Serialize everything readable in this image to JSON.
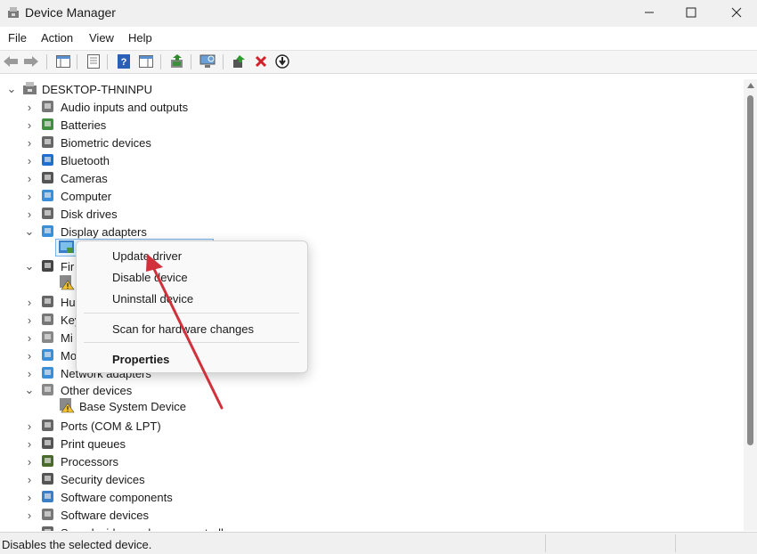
{
  "window": {
    "title": "Device Manager",
    "minimize": "—",
    "maximize": "☐",
    "close": "✕"
  },
  "menu": [
    "File",
    "Action",
    "View",
    "Help"
  ],
  "toolbar": {
    "icons": [
      "back-icon",
      "forward-icon",
      "show-hide-console-tree-icon",
      "properties-icon",
      "help-icon",
      "action-pane-icon",
      "update-driver-icon",
      "scan-hardware-icon",
      "enable-device-icon",
      "uninstall-device-icon",
      "disable-device-icon"
    ]
  },
  "tree": {
    "root": "DESKTOP-THNINPU",
    "items": [
      {
        "label": "Audio inputs and outputs",
        "icon": "speaker-icon",
        "expanded": false
      },
      {
        "label": "Batteries",
        "icon": "battery-icon",
        "expanded": false
      },
      {
        "label": "Biometric devices",
        "icon": "fingerprint-icon",
        "expanded": false
      },
      {
        "label": "Bluetooth",
        "icon": "bluetooth-icon",
        "expanded": false
      },
      {
        "label": "Cameras",
        "icon": "camera-icon",
        "expanded": false
      },
      {
        "label": "Computer",
        "icon": "monitor-icon",
        "expanded": false
      },
      {
        "label": "Disk drives",
        "icon": "disk-icon",
        "expanded": false
      },
      {
        "label": "Display adapters",
        "icon": "display-adapter-icon",
        "expanded": true
      },
      {
        "label": "Fir",
        "icon": "firmware-icon",
        "expanded": true
      },
      {
        "label": "Hu",
        "icon": "hid-icon",
        "expanded": false
      },
      {
        "label": "Key",
        "icon": "keyboard-icon",
        "expanded": false
      },
      {
        "label": "Mi",
        "icon": "mouse-icon",
        "expanded": false
      },
      {
        "label": "Mo",
        "icon": "monitor-icon",
        "expanded": false
      },
      {
        "label": "Network adapters",
        "icon": "network-icon",
        "expanded": false
      },
      {
        "label": "Other devices",
        "icon": "other-devices-icon",
        "expanded": true
      },
      {
        "label": "Ports (COM & LPT)",
        "icon": "port-icon",
        "expanded": false
      },
      {
        "label": "Print queues",
        "icon": "printer-icon",
        "expanded": false
      },
      {
        "label": "Processors",
        "icon": "processor-icon",
        "expanded": false
      },
      {
        "label": "Security devices",
        "icon": "security-icon",
        "expanded": false
      },
      {
        "label": "Software components",
        "icon": "software-icon",
        "expanded": false
      },
      {
        "label": "Software devices",
        "icon": "software-device-icon",
        "expanded": false
      },
      {
        "label": "Sound, video and game controllers",
        "icon": "sound-icon",
        "expanded": false
      }
    ],
    "children": {
      "other_devices_child": "Base System Device"
    }
  },
  "context_menu": {
    "items": [
      "Update driver",
      "Disable device",
      "Uninstall device",
      "Scan for hardware changes",
      "Properties"
    ]
  },
  "status": {
    "text": "Disables the selected device."
  },
  "colors": {
    "accent_arrow": "#d0313a",
    "selection": "#e5f1fb",
    "selection_border": "#7ab3e6"
  }
}
